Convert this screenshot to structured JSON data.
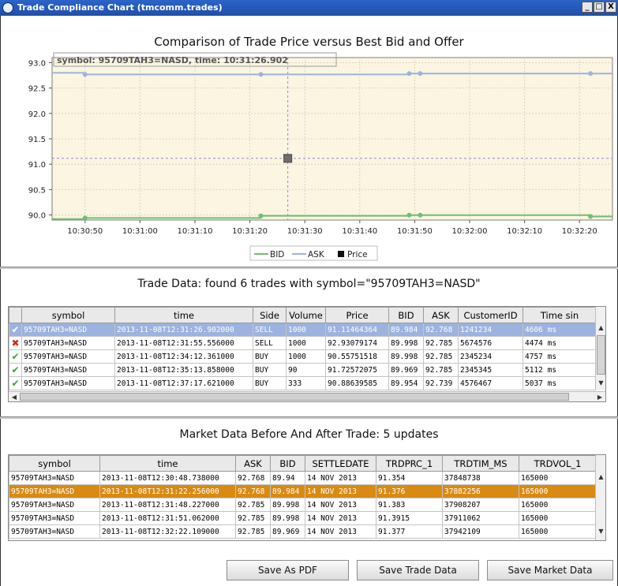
{
  "window": {
    "title": "Trade Compliance Chart (tmcomm.trades)",
    "buttons": [
      "_",
      "□",
      "X"
    ]
  },
  "chart": {
    "title": "Comparison of Trade Price versus Best Bid and Offer",
    "tooltip": "symbol: 95709TAH3=NASD, time: 10:31:26.902",
    "y_ticks": [
      "93.0",
      "92.5",
      "92.0",
      "91.5",
      "91.0",
      "90.5",
      "90.0"
    ],
    "x_ticks": [
      "10:30:50",
      "10:31:00",
      "10:31:10",
      "10:31:20",
      "10:31:30",
      "10:31:40",
      "10:31:50",
      "10:32:00",
      "10:32:10",
      "10:32:20"
    ],
    "legend": [
      "BID",
      "ASK",
      "Price"
    ],
    "colors": {
      "bid": "#6fbf6f",
      "ask": "#9db4e0",
      "price": "#6e6e6e",
      "plot_bg": "#fbf5e1",
      "crosshair": "#8a8adc"
    }
  },
  "chart_data": {
    "type": "line",
    "title": "Comparison of Trade Price versus Best Bid and Offer",
    "xlabel": "",
    "ylabel": "",
    "ylim": [
      89.9,
      93.1
    ],
    "xlim": [
      "10:30:44",
      "10:32:26"
    ],
    "series": [
      {
        "name": "ASK",
        "x": [
          "10:30:44",
          "10:30:50",
          "10:31:22",
          "10:31:49",
          "10:31:51",
          "10:32:22",
          "10:32:26"
        ],
        "y": [
          92.8,
          92.768,
          92.768,
          92.785,
          92.785,
          92.785,
          92.785
        ]
      },
      {
        "name": "BID",
        "x": [
          "10:30:44",
          "10:30:50",
          "10:31:22",
          "10:31:49",
          "10:31:51",
          "10:32:22",
          "10:32:26"
        ],
        "y": [
          89.92,
          89.94,
          89.984,
          89.998,
          89.998,
          89.969,
          89.969
        ]
      },
      {
        "name": "Price",
        "x": [
          "10:31:26.902"
        ],
        "y": [
          91.1146
        ]
      }
    ],
    "grid": true,
    "legend_position": "bottom"
  },
  "trades": {
    "title": "Trade Data: found 6 trades with symbol=\"95709TAH3=NASD\"",
    "columns": [
      "symbol",
      "time",
      "Side",
      "Volume",
      "Price",
      "BID",
      "ASK",
      "CustomerID",
      "Time sin"
    ],
    "rows": [
      {
        "status": "ok",
        "cells": [
          "95709TAH3=NASD",
          "2013-11-08T12:31:26.902000",
          "SELL",
          "1000",
          "91.11464364",
          "89.984",
          "92.768",
          "1241234",
          "4606 ms"
        ]
      },
      {
        "status": "bad",
        "cells": [
          "95709TAH3=NASD",
          "2013-11-08T12:31:55.556000",
          "SELL",
          "1000",
          "92.93079174",
          "89.998",
          "92.785",
          "5674576",
          "4474 ms"
        ]
      },
      {
        "status": "ok",
        "cells": [
          "95709TAH3=NASD",
          "2013-11-08T12:34:12.361000",
          "BUY",
          "1000",
          "90.55751518",
          "89.998",
          "92.785",
          "2345234",
          "4757 ms"
        ]
      },
      {
        "status": "ok",
        "cells": [
          "95709TAH3=NASD",
          "2013-11-08T12:35:13.858000",
          "BUY",
          "90",
          "91.72572075",
          "89.969",
          "92.785",
          "2345345",
          "5112 ms"
        ]
      },
      {
        "status": "ok",
        "cells": [
          "95709TAH3=NASD",
          "2013-11-08T12:37:17.621000",
          "BUY",
          "333",
          "90.88639585",
          "89.954",
          "92.739",
          "4576467",
          "5037 ms"
        ]
      }
    ]
  },
  "market": {
    "title": "Market Data Before And After Trade: 5 updates",
    "columns": [
      "symbol",
      "time",
      "ASK",
      "BID",
      "SETTLEDATE",
      "TRDPRC_1",
      "TRDTIM_MS",
      "TRDVOL_1"
    ],
    "rows": [
      [
        "95709TAH3=NASD",
        "2013-11-08T12:30:48.738000",
        "92.768",
        "89.94",
        "14 NOV 2013",
        "91.354",
        "37848738",
        "165000"
      ],
      [
        "95709TAH3=NASD",
        "2013-11-08T12:31:22.256000",
        "92.768",
        "89.984",
        "14 NOV 2013",
        "91.376",
        "37882256",
        "165000"
      ],
      [
        "95709TAH3=NASD",
        "2013-11-08T12:31:48.227000",
        "92.785",
        "89.998",
        "14 NOV 2013",
        "91.383",
        "37908207",
        "165000"
      ],
      [
        "95709TAH3=NASD",
        "2013-11-08T12:31:51.062000",
        "92.785",
        "89.998",
        "14 NOV 2013",
        "91.3915",
        "37911062",
        "165000"
      ],
      [
        "95709TAH3=NASD",
        "2013-11-08T12:32:22.109000",
        "92.785",
        "89.969",
        "14 NOV 2013",
        "91.377",
        "37942109",
        "165000"
      ]
    ]
  },
  "actions": {
    "save_pdf": "Save As PDF",
    "save_trade": "Save Trade Data",
    "save_market": "Save Market Data"
  }
}
